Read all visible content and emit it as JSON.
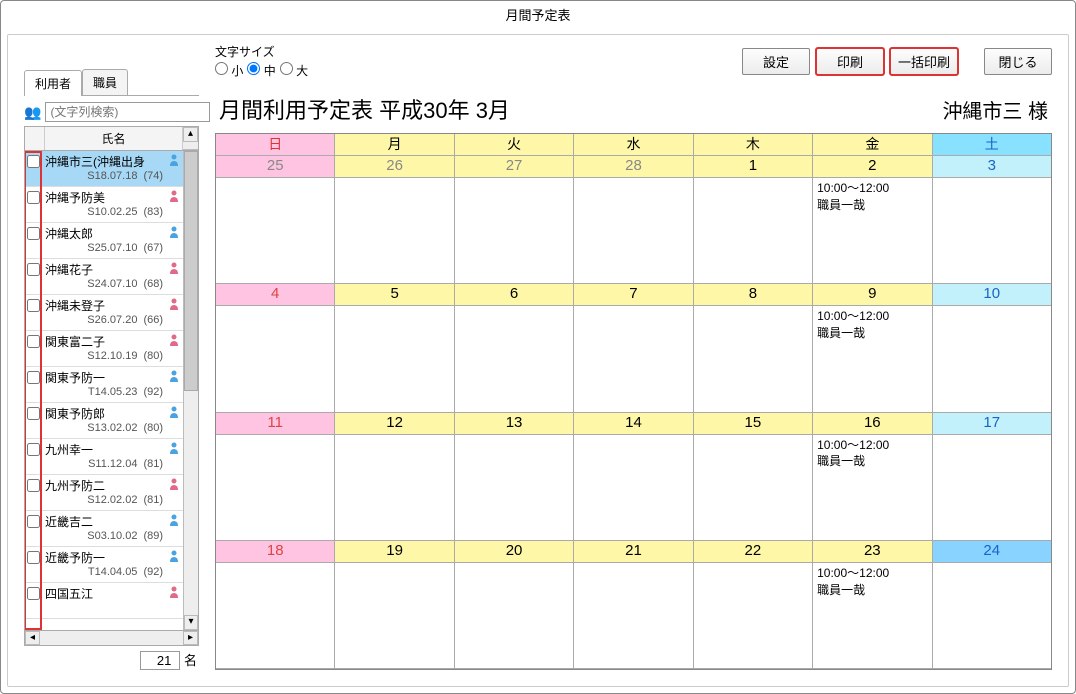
{
  "window": {
    "title": "月間予定表"
  },
  "sidebar": {
    "tabs": [
      "利用者",
      "職員"
    ],
    "active_tab": 0,
    "search_placeholder": "(文字列検索)",
    "name_header": "氏名",
    "count_value": "21",
    "count_suffix": "名",
    "people_icon": "👥",
    "items": [
      {
        "name": "沖縄市三(沖縄出身",
        "sub": "S18.07.18",
        "age": "(74)",
        "gender": "m",
        "selected": true
      },
      {
        "name": "沖縄予防美",
        "sub": "S10.02.25",
        "age": "(83)",
        "gender": "f"
      },
      {
        "name": "沖縄太郎",
        "sub": "S25.07.10",
        "age": "(67)",
        "gender": "m"
      },
      {
        "name": "沖縄花子",
        "sub": "S24.07.10",
        "age": "(68)",
        "gender": "f"
      },
      {
        "name": "沖縄未登子",
        "sub": "S26.07.20",
        "age": "(66)",
        "gender": "f"
      },
      {
        "name": "関東富二子",
        "sub": "S12.10.19",
        "age": "(80)",
        "gender": "f"
      },
      {
        "name": "関東予防一",
        "sub": "T14.05.23",
        "age": "(92)",
        "gender": "m"
      },
      {
        "name": "関東予防郎",
        "sub": "S13.02.02",
        "age": "(80)",
        "gender": "m"
      },
      {
        "name": "九州幸一",
        "sub": "S11.12.04",
        "age": "(81)",
        "gender": "m"
      },
      {
        "name": "九州予防二",
        "sub": "S12.02.02",
        "age": "(81)",
        "gender": "f"
      },
      {
        "name": "近畿吉二",
        "sub": "S03.10.02",
        "age": "(89)",
        "gender": "m"
      },
      {
        "name": "近畿予防一",
        "sub": "T14.04.05",
        "age": "(92)",
        "gender": "m"
      },
      {
        "name": "四国五江",
        "sub": "",
        "age": "",
        "gender": "f"
      }
    ]
  },
  "toolbar": {
    "font_size_label": "文字サイズ",
    "font_options": [
      "小",
      "中",
      "大"
    ],
    "font_selected": 1,
    "settings": "設定",
    "print": "印刷",
    "batch_print": "一括印刷",
    "close": "閉じる"
  },
  "calendar": {
    "title": "月間利用予定表 平成30年 3月",
    "user": "沖縄市三 様",
    "day_headers": [
      "日",
      "月",
      "火",
      "水",
      "木",
      "金",
      "土"
    ],
    "weeks": [
      {
        "cells": [
          {
            "date": "25",
            "type": "sun",
            "other": true,
            "events": []
          },
          {
            "date": "26",
            "type": "wk",
            "other": true,
            "events": []
          },
          {
            "date": "27",
            "type": "wk",
            "other": true,
            "events": []
          },
          {
            "date": "28",
            "type": "wk",
            "other": true,
            "events": []
          },
          {
            "date": "1",
            "type": "wk",
            "events": []
          },
          {
            "date": "2",
            "type": "wk",
            "events": [
              "10:00～12:00",
              "職員一哉"
            ]
          },
          {
            "date": "3",
            "type": "sat",
            "events": []
          }
        ]
      },
      {
        "cells": [
          {
            "date": "4",
            "type": "sun",
            "events": []
          },
          {
            "date": "5",
            "type": "wk",
            "events": []
          },
          {
            "date": "6",
            "type": "wk",
            "events": []
          },
          {
            "date": "7",
            "type": "wk",
            "events": []
          },
          {
            "date": "8",
            "type": "wk",
            "events": []
          },
          {
            "date": "9",
            "type": "wk",
            "events": [
              "10:00～12:00",
              "職員一哉"
            ]
          },
          {
            "date": "10",
            "type": "sat",
            "events": []
          }
        ]
      },
      {
        "cells": [
          {
            "date": "11",
            "type": "sun",
            "events": []
          },
          {
            "date": "12",
            "type": "wk",
            "events": []
          },
          {
            "date": "13",
            "type": "wk",
            "events": []
          },
          {
            "date": "14",
            "type": "wk",
            "events": []
          },
          {
            "date": "15",
            "type": "wk",
            "events": []
          },
          {
            "date": "16",
            "type": "wk",
            "events": [
              "10:00～12:00",
              "職員一哉"
            ]
          },
          {
            "date": "17",
            "type": "sat",
            "events": []
          }
        ]
      },
      {
        "cells": [
          {
            "date": "18",
            "type": "sun",
            "events": []
          },
          {
            "date": "19",
            "type": "wk",
            "events": []
          },
          {
            "date": "20",
            "type": "wk",
            "events": []
          },
          {
            "date": "21",
            "type": "wk",
            "events": []
          },
          {
            "date": "22",
            "type": "wk",
            "events": []
          },
          {
            "date": "23",
            "type": "wk",
            "events": [
              "10:00～12:00",
              "職員一哉"
            ]
          },
          {
            "date": "24",
            "type": "sat",
            "curr": true,
            "events": []
          }
        ]
      }
    ]
  }
}
